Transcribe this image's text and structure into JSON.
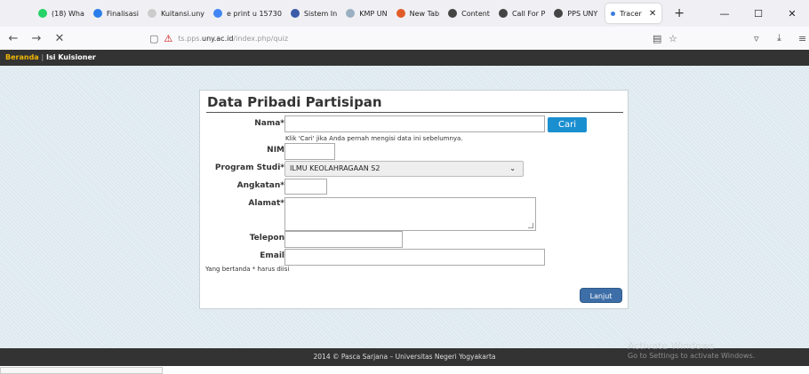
{
  "browser": {
    "tabs": [
      {
        "label": "(18) Wha",
        "color": "#25d366"
      },
      {
        "label": "Finalisasi",
        "color": "#2b7de9"
      },
      {
        "label": "Kuitansi.uny",
        "color": "#cccccc"
      },
      {
        "label": "e print u  15730",
        "color": "#4285f4"
      },
      {
        "label": "Sistem In",
        "color": "#3b5ba9"
      },
      {
        "label": "KMP UN",
        "color": "#9ab0c2"
      },
      {
        "label": "New Tab",
        "color": "#e25c2a"
      },
      {
        "label": "Content",
        "color": "#444444"
      },
      {
        "label": "Call For P",
        "color": "#444444"
      },
      {
        "label": "PPS UNY",
        "color": "#444444"
      }
    ],
    "active_tab": {
      "label": "Tracer",
      "color": "#3b7ddd"
    },
    "new_tab_icon": "+",
    "window_controls": {
      "minimize": "—",
      "maximize": "☐",
      "close": "✕"
    },
    "nav": {
      "back": "←",
      "forward": "→",
      "stop": "✕"
    },
    "url_prefix": "ts.pps.",
    "url_domain": "uny.ac.id",
    "url_path": "/index.php/quiz",
    "icons": {
      "reader": "▤",
      "bookmark": "☆",
      "pocket": "▿",
      "download": "⤓",
      "menu": "≡",
      "shield": "▢",
      "lock": "⚠"
    }
  },
  "site_nav": {
    "home": "Beranda",
    "separator": "|",
    "current": "Isi Kuisioner"
  },
  "form": {
    "title": "Data Pribadi Partisipan",
    "fields": {
      "nama": {
        "label": "Nama*",
        "value": ""
      },
      "nim": {
        "label": "NIM",
        "value": ""
      },
      "program_studi": {
        "label": "Program Studi*",
        "selected": "ILMU KEOLAHRAGAAN S2"
      },
      "angkatan": {
        "label": "Angkatan*",
        "value": ""
      },
      "alamat": {
        "label": "Alamat*",
        "value": ""
      },
      "telepon": {
        "label": "Telepon",
        "value": ""
      },
      "email": {
        "label": "Email",
        "value": ""
      }
    },
    "cari_label": "Cari",
    "hint": "Klik 'Cari' jika Anda pernah mengisi data ini sebelumnya.",
    "required_note": "Yang bertanda * harus diisi",
    "submit_label": "Lanjut"
  },
  "footer": "2014 © Pasca Sarjana – Universitas Negeri Yogyakarta",
  "watermark": {
    "title": "Activate Windows",
    "subtitle": "Go to Settings to activate Windows."
  }
}
